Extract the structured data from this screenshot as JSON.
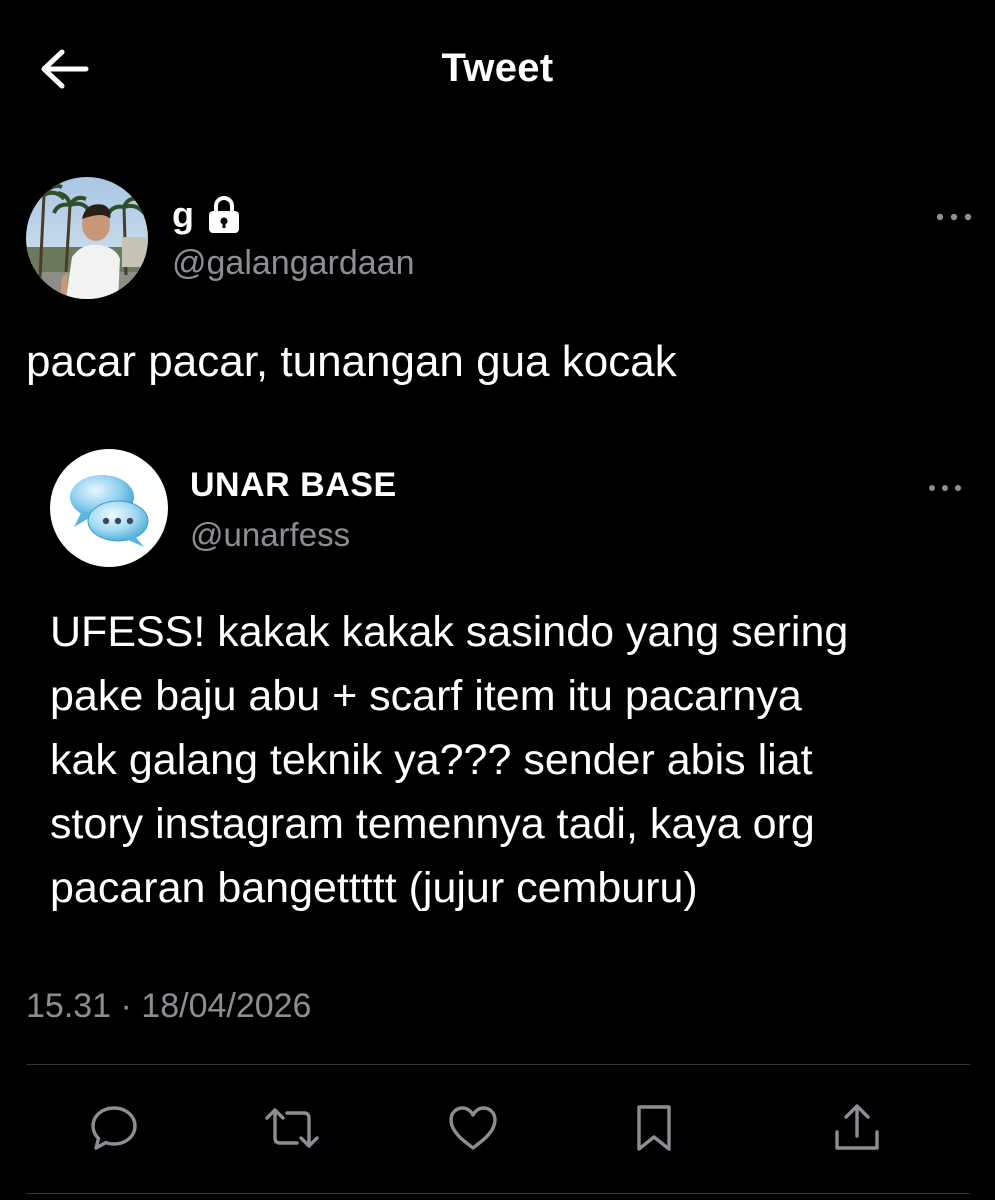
{
  "header": {
    "title": "Tweet",
    "back_icon": "arrow-left-icon"
  },
  "tweet": {
    "author": {
      "display_name": "g",
      "handle": "@galangardaan",
      "protected_icon": "lock-icon",
      "avatar": "profile-photo"
    },
    "text": "pacar pacar, tunangan gua kocak",
    "more_icon": "more-horizontal-icon",
    "timestamp": "15.31 · 18/04/2026"
  },
  "quoted_tweet": {
    "author": {
      "display_name": "UNAR BASE",
      "handle": "@unarfess",
      "avatar": "chat-bubbles-icon"
    },
    "text": "UFESS! kakak kakak sasindo yang sering\npake baju abu + scarf item itu pacarnya\nkak galang teknik ya??? sender abis liat\nstory instagram temennya tadi, kaya org\npacaran bangettttt (jujur cemburu)",
    "more_icon": "more-horizontal-icon"
  },
  "actions": [
    {
      "name": "reply",
      "icon": "reply-icon"
    },
    {
      "name": "retweet",
      "icon": "retweet-icon"
    },
    {
      "name": "like",
      "icon": "heart-icon"
    },
    {
      "name": "bookmark",
      "icon": "bookmark-icon"
    },
    {
      "name": "share",
      "icon": "share-icon"
    }
  ],
  "colors": {
    "background": "#000000",
    "text_primary": "#ffffff",
    "text_secondary": "#8b8f94",
    "divider": "#2f3336",
    "icon": "#8b8f94"
  }
}
